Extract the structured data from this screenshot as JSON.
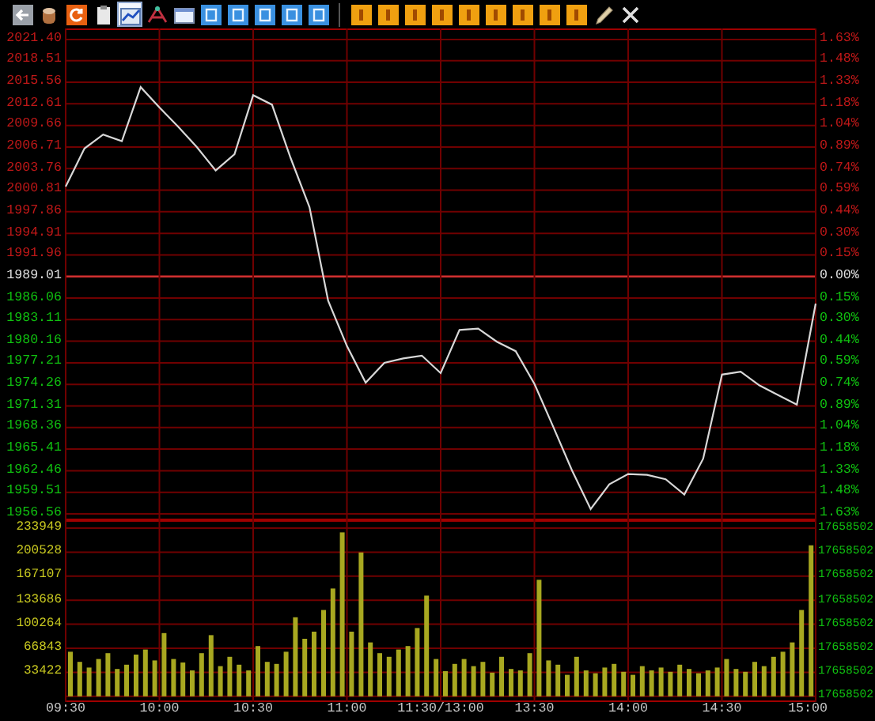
{
  "toolbar": [
    {
      "kind": "back",
      "selected": false
    },
    {
      "kind": "cup",
      "selected": false
    },
    {
      "kind": "refresh",
      "selected": false
    },
    {
      "kind": "clipboard",
      "selected": false
    },
    {
      "kind": "chart",
      "selected": true
    },
    {
      "kind": "network",
      "selected": false
    },
    {
      "kind": "window",
      "selected": false
    },
    {
      "kind": "blue",
      "selected": false
    },
    {
      "kind": "blue",
      "selected": false
    },
    {
      "kind": "blue",
      "selected": false
    },
    {
      "kind": "blue",
      "selected": false
    },
    {
      "kind": "blue",
      "selected": false
    },
    {
      "kind": "separator"
    },
    {
      "kind": "orange",
      "selected": false
    },
    {
      "kind": "orange",
      "selected": false
    },
    {
      "kind": "orange",
      "selected": false
    },
    {
      "kind": "orange",
      "selected": false
    },
    {
      "kind": "orange",
      "selected": false
    },
    {
      "kind": "orange",
      "selected": false
    },
    {
      "kind": "orange",
      "selected": false
    },
    {
      "kind": "orange",
      "selected": false
    },
    {
      "kind": "orange",
      "selected": false
    },
    {
      "kind": "pen",
      "selected": false
    },
    {
      "kind": "close",
      "selected": false
    }
  ],
  "price_panel": {
    "chart_data": {
      "type": "line",
      "categories": [
        null,
        null,
        null,
        null,
        null,
        null,
        null,
        null,
        null,
        null,
        null,
        null,
        null,
        null,
        null,
        null,
        null,
        null,
        null,
        null,
        null,
        null,
        null,
        null,
        null,
        null,
        null,
        null,
        null,
        null,
        null,
        null,
        null,
        null,
        null,
        null,
        null,
        null,
        null,
        null,
        null
      ],
      "series": [
        {
          "color": "#d8d8d8",
          "values": [
            2001.3,
            2006.5,
            2008.4,
            2007.5,
            2014.9,
            2012.1,
            2009.5,
            2006.7,
            2003.5,
            2005.7,
            2013.8,
            2012.5,
            2005.2,
            1998.5,
            1985.7,
            1979.5,
            1974.5,
            1977.2,
            1977.8,
            1978.2,
            1975.8,
            1981.7,
            1981.9,
            1980.1,
            1978.8,
            1974.3,
            1968.5,
            1962.5,
            1957.2,
            1960.6,
            1962.0,
            1961.9,
            1961.3,
            1959.2,
            1964.1,
            1975.6,
            1976.0,
            1974.1,
            1972.8,
            1971.5,
            1985.3
          ]
        }
      ],
      "ylim": [
        1956.56,
        2021.4
      ],
      "grid": true,
      "yticks": [
        {
          "value": 2021.4,
          "label": "2021.40"
        },
        {
          "value": 2018.51,
          "label": "2018.51"
        },
        {
          "value": 2015.56,
          "label": "2015.56"
        },
        {
          "value": 2012.61,
          "label": "2012.61"
        },
        {
          "value": 2009.66,
          "label": "2009.66"
        },
        {
          "value": 2006.71,
          "label": "2006.71"
        },
        {
          "value": 2003.76,
          "label": "2003.76"
        },
        {
          "value": 2000.81,
          "label": "2000.81"
        },
        {
          "value": 1997.86,
          "label": "1997.86"
        },
        {
          "value": 1994.91,
          "label": "1994.91"
        },
        {
          "value": 1991.96,
          "label": "1991.96"
        },
        {
          "value": 1989.01,
          "label": "1989.01"
        },
        {
          "value": 1986.06,
          "label": "1986.06"
        },
        {
          "value": 1983.11,
          "label": "1983.11"
        },
        {
          "value": 1980.16,
          "label": "1980.16"
        },
        {
          "value": 1977.21,
          "label": "1977.21"
        },
        {
          "value": 1974.26,
          "label": "1974.26"
        },
        {
          "value": 1971.31,
          "label": "1971.31"
        },
        {
          "value": 1968.36,
          "label": "1968.36"
        },
        {
          "value": 1965.41,
          "label": "1965.41"
        },
        {
          "value": 1962.46,
          "label": "1962.46"
        },
        {
          "value": 1959.51,
          "label": "1959.51"
        },
        {
          "value": 1956.56,
          "label": "1956.56"
        }
      ],
      "ref_lines": [
        {
          "axis": "y",
          "value": 1989.01
        }
      ]
    },
    "right_labels": [
      "1.63%",
      "1.48%",
      "1.33%",
      "1.18%",
      "1.04%",
      "0.89%",
      "0.74%",
      "0.59%",
      "0.44%",
      "0.30%",
      "0.15%",
      "0.00%",
      "0.15%",
      "0.30%",
      "0.44%",
      "0.59%",
      "0.74%",
      "0.89%",
      "1.04%",
      "1.18%",
      "1.33%",
      "1.48%",
      "1.63%"
    ]
  },
  "volume_panel": {
    "chart_data": {
      "type": "bar",
      "categories": [
        null,
        null,
        null,
        null,
        null,
        null,
        null,
        null,
        null,
        null,
        null,
        null,
        null,
        null,
        null,
        null,
        null,
        null,
        null,
        null,
        null,
        null,
        null,
        null,
        null,
        null,
        null,
        null,
        null,
        null,
        null,
        null,
        null,
        null,
        null,
        null,
        null,
        null,
        null,
        null,
        null,
        null,
        null,
        null,
        null,
        null,
        null,
        null,
        null,
        null,
        null,
        null,
        null,
        null,
        null,
        null,
        null,
        null,
        null,
        null,
        null,
        null,
        null,
        null,
        null,
        null,
        null,
        null,
        null,
        null,
        null,
        null,
        null,
        null,
        null,
        null,
        null,
        null,
        null,
        null
      ],
      "series": [
        {
          "color": "#a8a820",
          "values": [
            62000,
            48000,
            40000,
            52000,
            60000,
            38000,
            44000,
            58000,
            65000,
            50000,
            88000,
            52000,
            47000,
            36000,
            60000,
            85000,
            42000,
            55000,
            44000,
            36000,
            70000,
            48000,
            45000,
            62000,
            110000,
            80000,
            90000,
            120000,
            150000,
            228000,
            90000,
            200000,
            75000,
            60000,
            55000,
            65000,
            70000,
            95000,
            140000,
            52000,
            35000,
            45000,
            52000,
            42000,
            48000,
            33000,
            55000,
            38000,
            36000,
            60000,
            162000,
            50000,
            44000,
            30000,
            55000,
            36000,
            32000,
            40000,
            45000,
            34000,
            30000,
            42000,
            36000,
            40000,
            34000,
            44000,
            38000,
            32000,
            36000,
            40000,
            52000,
            38000,
            34000,
            48000,
            42000,
            55000,
            62000,
            75000,
            120000,
            210000
          ]
        }
      ],
      "ylim": [
        0,
        233949
      ],
      "grid": true,
      "yticks": [
        {
          "value": 233949,
          "label": "233949"
        },
        {
          "value": 200528,
          "label": "200528"
        },
        {
          "value": 167107,
          "label": "167107"
        },
        {
          "value": 133686,
          "label": "133686"
        },
        {
          "value": 100264,
          "label": "100264"
        },
        {
          "value": 66843,
          "label": "66843"
        },
        {
          "value": 33422,
          "label": "33422"
        }
      ]
    },
    "right_labels": [
      "17658502",
      "17658502",
      "17658502",
      "17658502",
      "17658502",
      "17658502",
      "17658502",
      "17658502"
    ],
    "time_labels": [
      "09:30",
      "10:00",
      "10:30",
      "11:00",
      "11:30/13:00",
      "13:30",
      "14:00",
      "14:30",
      "15:00"
    ]
  }
}
